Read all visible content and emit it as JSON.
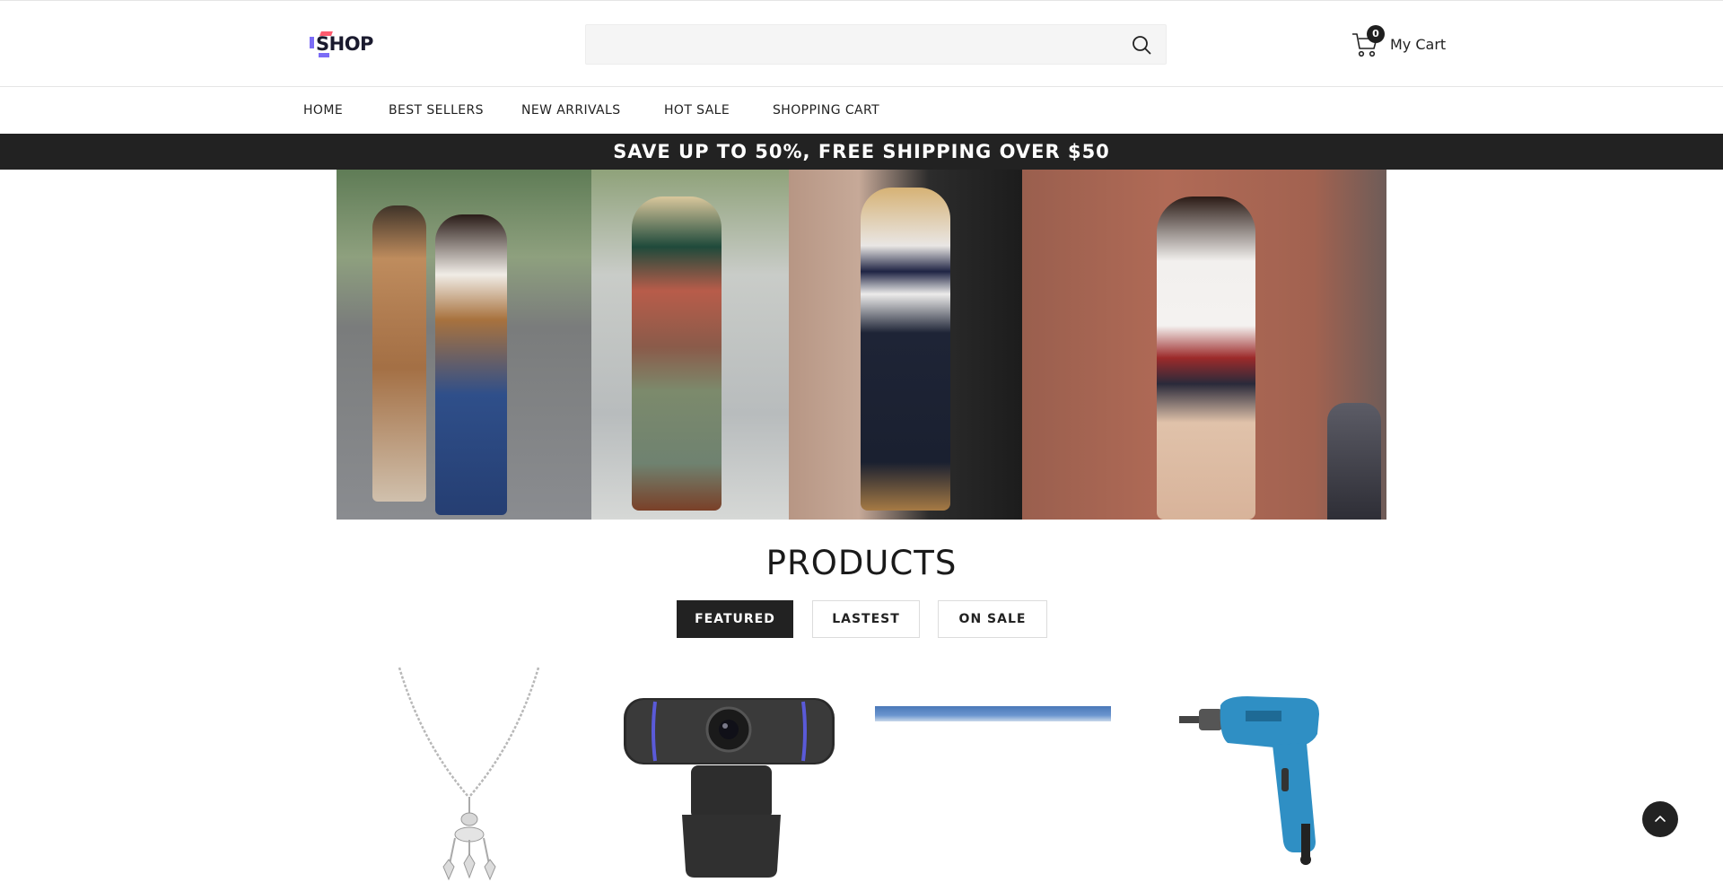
{
  "header": {
    "logo_text": "SHOP",
    "search": {
      "placeholder": "",
      "value": "",
      "icon": "search-icon"
    },
    "cart": {
      "count": "0",
      "label": "My Cart",
      "icon": "cart-icon"
    }
  },
  "nav": {
    "items": [
      {
        "label": "HOME"
      },
      {
        "label": "BEST SELLERS"
      },
      {
        "label": "NEW ARRIVALS"
      },
      {
        "label": "HOT SALE"
      },
      {
        "label": "SHOPPING CART"
      }
    ]
  },
  "promo": {
    "text": "SAVE UP TO 50%, FREE SHIPPING OVER $50"
  },
  "products": {
    "title": "PRODUCTS",
    "tabs": [
      {
        "label": "FEATURED",
        "active": true
      },
      {
        "label": "LASTEST",
        "active": false
      },
      {
        "label": "ON SALE",
        "active": false
      }
    ]
  },
  "colors": {
    "dark": "#222222",
    "accent_purple": "#7b6cf6",
    "accent_pink": "#ff5a6e",
    "drill_blue": "#2f8fc4"
  },
  "icons": {
    "back_to_top": "chevron-up-icon"
  }
}
